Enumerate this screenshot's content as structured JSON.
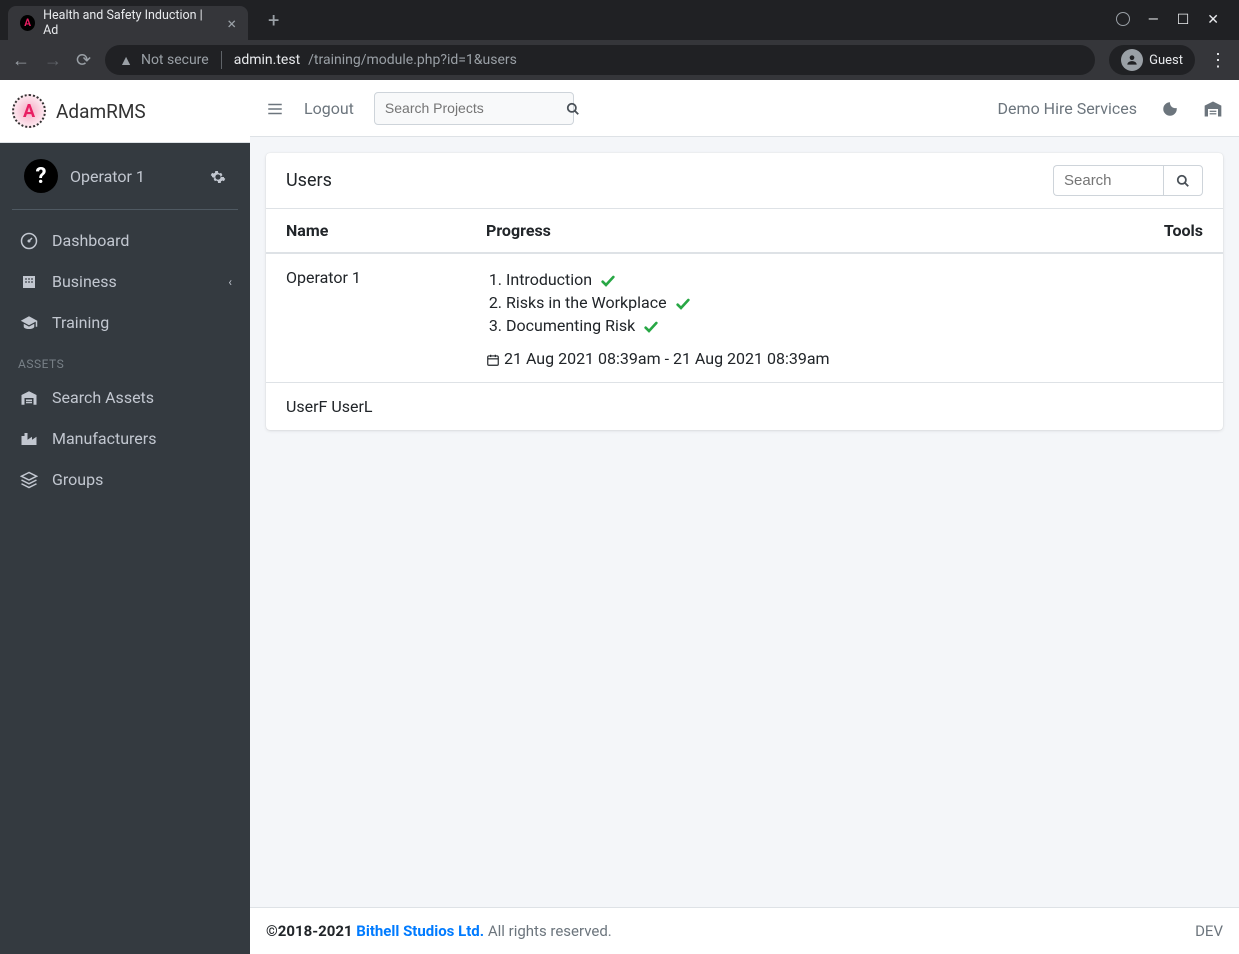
{
  "browser": {
    "tab_title": "Health and Safety Induction | Ad",
    "not_secure": "Not secure",
    "url_host": "admin.test",
    "url_path": "/training/module.php?id=1&users",
    "guest_label": "Guest"
  },
  "brand": {
    "name": "AdamRMS"
  },
  "user": {
    "name": "Operator 1"
  },
  "sidebar": {
    "items": [
      {
        "label": "Dashboard"
      },
      {
        "label": "Business"
      },
      {
        "label": "Training"
      }
    ],
    "assets_header": "ASSETS",
    "asset_items": [
      {
        "label": "Search Assets"
      },
      {
        "label": "Manufacturers"
      },
      {
        "label": "Groups"
      }
    ]
  },
  "topbar": {
    "logout": "Logout",
    "search_placeholder": "Search Projects",
    "org_name": "Demo Hire Services"
  },
  "card": {
    "title": "Users",
    "search_placeholder": "Search",
    "columns": {
      "name": "Name",
      "progress": "Progress",
      "tools": "Tools"
    },
    "rows": [
      {
        "name": "Operator 1",
        "progress": [
          {
            "label": "Introduction",
            "done": true
          },
          {
            "label": "Risks in the Workplace",
            "done": true
          },
          {
            "label": "Documenting Risk",
            "done": true
          }
        ],
        "timestamp": "21 Aug 2021 08:39am - 21 Aug 2021 08:39am"
      },
      {
        "name": "UserF UserL",
        "progress": [],
        "timestamp": ""
      }
    ]
  },
  "footer": {
    "copyright": "©2018-2021 ",
    "company": "Bithell Studios Ltd.",
    "rights": " All rights reserved.",
    "env": "DEV"
  }
}
